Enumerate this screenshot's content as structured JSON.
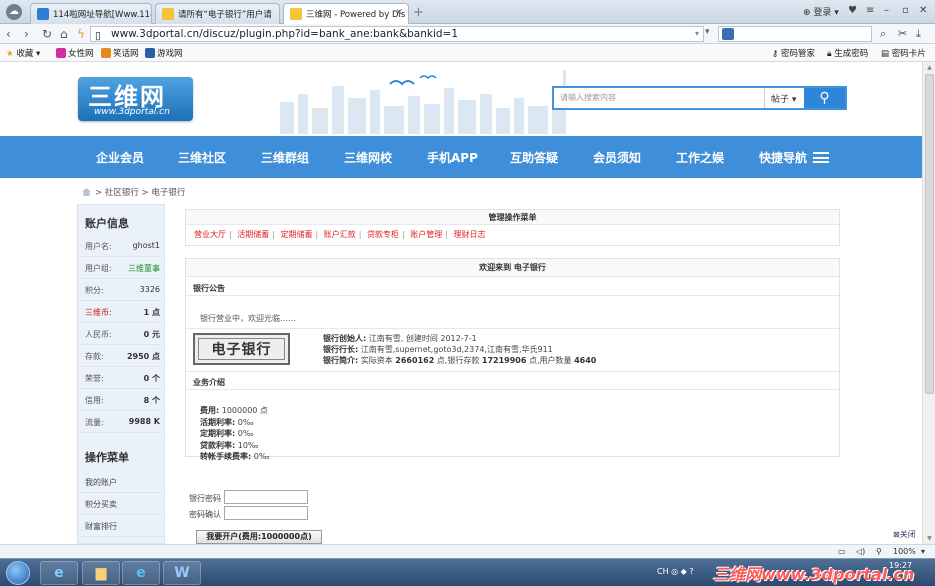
{
  "browser": {
    "tabs": [
      {
        "label": "114啦网址导航[Www.114",
        "fav_color": "#2f7dd6"
      },
      {
        "label": "请所有“电子银行”用户请",
        "fav_color": "#f3c33a"
      },
      {
        "label": "三维网 - Powered by Dis",
        "fav_color": "#f3c33a"
      }
    ],
    "login_label": "登录 ▾",
    "url": "www.3dportal.cn/discuz/plugin.php?id=bank_ane:bank&bankid=1",
    "favorites": [
      {
        "label": "收藏 ▾"
      },
      {
        "label": "女性网",
        "color": "#d12f9e"
      },
      {
        "label": "笑话网",
        "color": "#e28a1b"
      },
      {
        "label": "游戏网",
        "color": "#2b5ea8"
      }
    ],
    "tools": [
      {
        "label": "密码管家"
      },
      {
        "label": "生成密码"
      },
      {
        "label": "密码卡片"
      }
    ]
  },
  "site": {
    "logo_text": "三维网",
    "logo_url": "www.3dportal.cn",
    "search_placeholder": "请输入搜索内容",
    "search_scope": "帖子 ▾",
    "nav": [
      "企业会员",
      "三维社区",
      "三维群组",
      "三维网校",
      "手机APP",
      "互助答疑",
      "会员须知",
      "工作之娱",
      "快捷导航"
    ],
    "breadcrumb": "> 社区银行 > 电子银行"
  },
  "sidebar": {
    "account_title": "账户信息",
    "rows": [
      {
        "k": "用户名:",
        "v": "ghost1"
      },
      {
        "k": "用户组:",
        "v": "三维董事"
      },
      {
        "k": "积分:",
        "v": "3326"
      },
      {
        "k": "三维币:",
        "v": "1 点"
      },
      {
        "k": "人民币:",
        "v": "0 元"
      },
      {
        "k": "存款:",
        "v": "2950 点"
      },
      {
        "k": "荣誉:",
        "v": "0 个"
      },
      {
        "k": "信用:",
        "v": "8 个"
      },
      {
        "k": "流量:",
        "v": "9988 K"
      }
    ],
    "menu_title": "操作菜单",
    "menu": [
      "我的账户",
      "积分买卖",
      "财富排行"
    ]
  },
  "main": {
    "manage_title": "管理操作菜单",
    "menu_links": [
      "营业大厅",
      "活期储蓄",
      "定期储蓄",
      "账户汇款",
      "贷款专柜",
      "账户管理",
      "理财日志"
    ],
    "welcome_title": "欢迎来到 电子银行",
    "notice_title": "银行公告",
    "notice_text": "银行营业中，欢迎光临……",
    "bank_logo_text": "电子银行",
    "bank_info": {
      "founder_label": "银行创始人:",
      "founder_value": " 江南有雪, 创建时间 2012-7-1",
      "president_label": "银行行长:",
      "president_value": " 江南有雪,supernet,goto3d,2374,江南有雪,华氏911",
      "intro_label": "银行简介:",
      "intro_pre": " 实际资本 ",
      "capital": "2660162",
      "intro_mid": " 点,银行存款 ",
      "deposit": "17219906",
      "intro_mid2": " 点,用户数量 ",
      "users": "4640"
    },
    "biz_title": "业务介绍",
    "biz": [
      {
        "k": "费用:",
        "v": " 1000000 点"
      },
      {
        "k": "活期利率:",
        "v": " 0‰"
      },
      {
        "k": "定期利率:",
        "v": " 0‰"
      },
      {
        "k": "贷款利率:",
        "v": " 10‰"
      },
      {
        "k": "转帐手续费率:",
        "v": " 0‰"
      }
    ],
    "form": {
      "pwd_label": "银行密码",
      "confirm_label": "密码确认",
      "submit": "我要开户(费用:1000000点)"
    },
    "close_label": "关闭"
  },
  "statusbar": {
    "zoom": "100%"
  },
  "taskbar": {
    "tray_text": "CH ◎ ◆ ?",
    "watermark": "三维网www.3dportal.cn",
    "clock": "19:27"
  }
}
